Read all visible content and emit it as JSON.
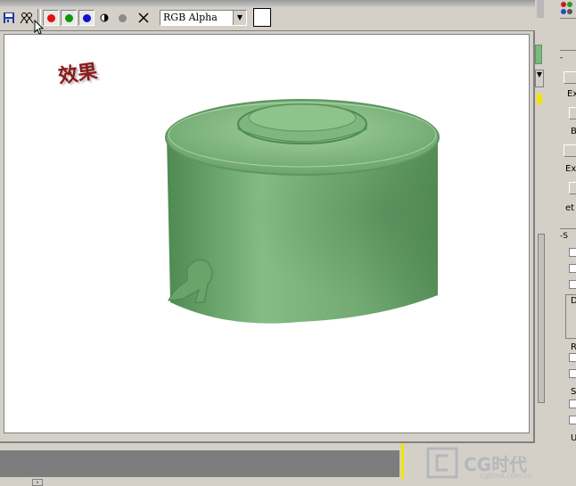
{
  "toolbar": {
    "channel_select": "RGB Alpha",
    "buttons": [
      {
        "name": "save-icon"
      },
      {
        "name": "clone-icon"
      },
      {
        "name": "red-channel-icon",
        "color": "#e01010"
      },
      {
        "name": "green-channel-icon",
        "color": "#0a9a0a"
      },
      {
        "name": "blue-channel-icon",
        "color": "#1010d0"
      },
      {
        "name": "alpha-channel-icon"
      },
      {
        "name": "monochrome-icon"
      },
      {
        "name": "clear-icon"
      }
    ]
  },
  "viewport": {
    "caption": "效果",
    "object_color": "#7ab27a"
  },
  "right_panel": {
    "labels": [
      "Ex",
      "B",
      "Ex",
      "et",
      "D",
      "R",
      "S",
      "U"
    ]
  },
  "watermark": {
    "brand": "CG时代",
    "url": "cgtime.com.cn"
  }
}
